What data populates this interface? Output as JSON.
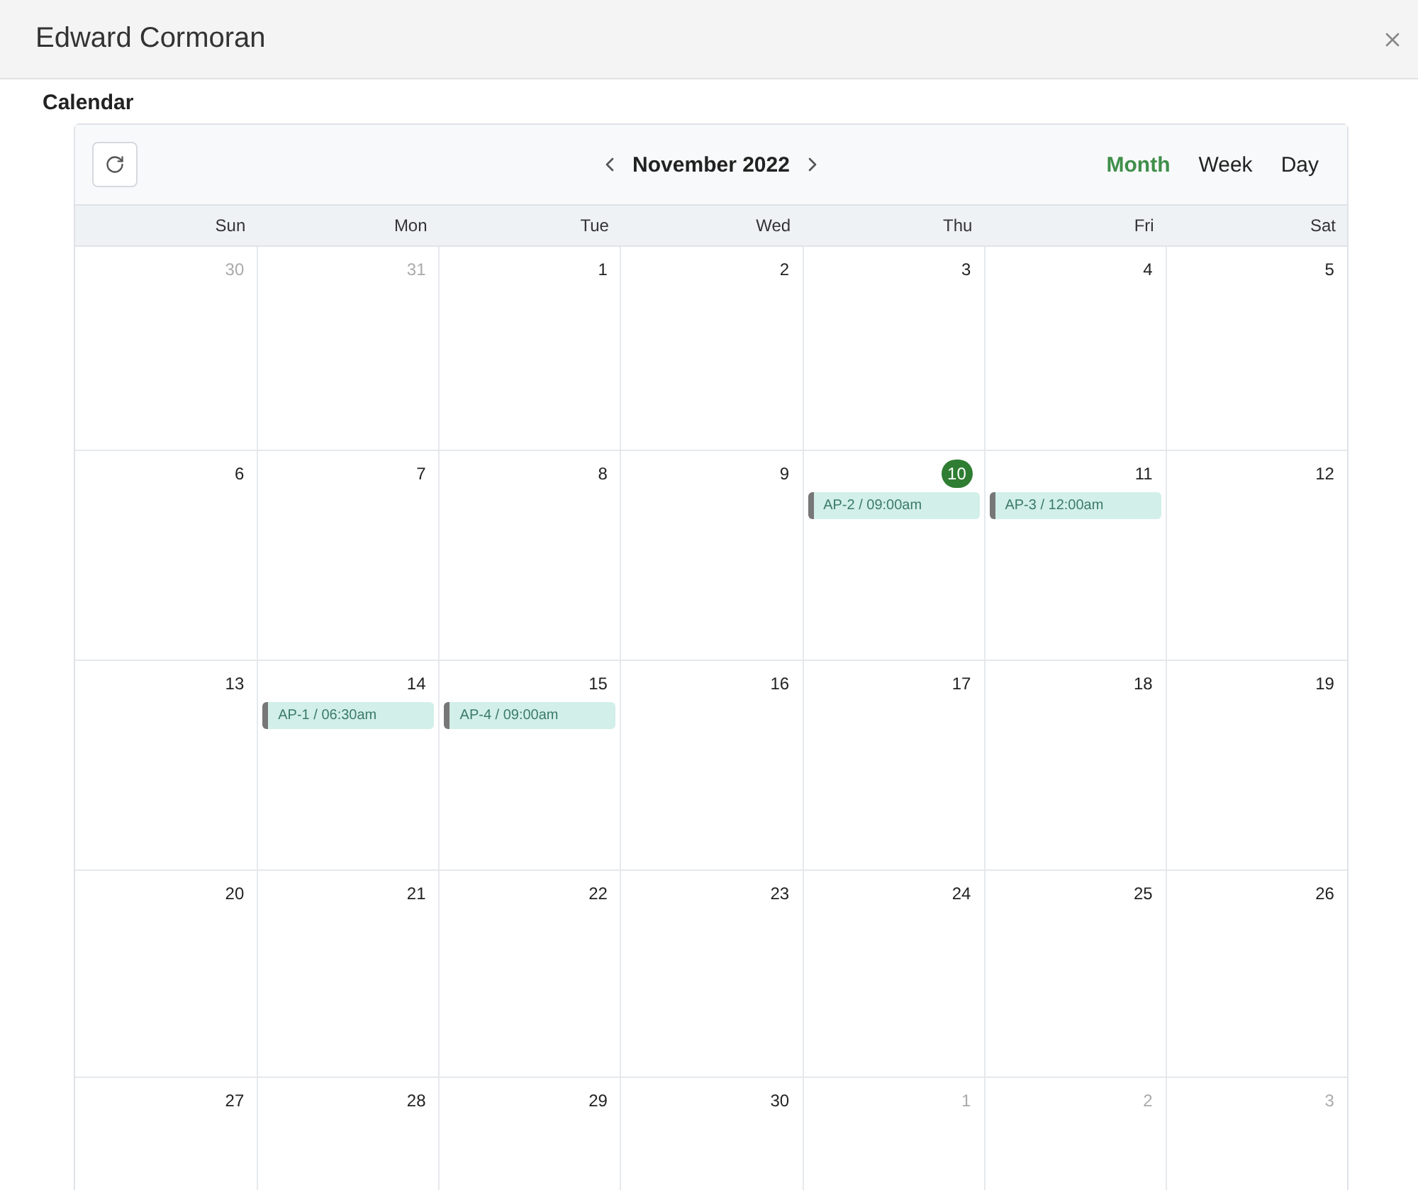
{
  "dialog": {
    "title": "Edward Cormoran"
  },
  "section_title": "Calendar",
  "toolbar": {
    "period": "November 2022",
    "views": [
      {
        "label": "Month",
        "selected": true
      },
      {
        "label": "Week",
        "selected": false
      },
      {
        "label": "Day",
        "selected": false
      }
    ]
  },
  "weekdays": [
    "Sun",
    "Mon",
    "Tue",
    "Wed",
    "Thu",
    "Fri",
    "Sat"
  ],
  "weeks": [
    [
      {
        "label": "30",
        "outside": true,
        "today": false
      },
      {
        "label": "31",
        "outside": true,
        "today": false
      },
      {
        "label": "1",
        "outside": false,
        "today": false
      },
      {
        "label": "2",
        "outside": false,
        "today": false
      },
      {
        "label": "3",
        "outside": false,
        "today": false
      },
      {
        "label": "4",
        "outside": false,
        "today": false
      },
      {
        "label": "5",
        "outside": false,
        "today": false
      }
    ],
    [
      {
        "label": "6",
        "outside": false,
        "today": false
      },
      {
        "label": "7",
        "outside": false,
        "today": false
      },
      {
        "label": "8",
        "outside": false,
        "today": false
      },
      {
        "label": "9",
        "outside": false,
        "today": false
      },
      {
        "label": "10",
        "outside": false,
        "today": true,
        "events": [
          "AP-2 / 09:00am"
        ]
      },
      {
        "label": "11",
        "outside": false,
        "today": false,
        "events": [
          "AP-3 / 12:00am"
        ]
      },
      {
        "label": "12",
        "outside": false,
        "today": false
      }
    ],
    [
      {
        "label": "13",
        "outside": false,
        "today": false
      },
      {
        "label": "14",
        "outside": false,
        "today": false,
        "events": [
          "AP-1 / 06:30am"
        ]
      },
      {
        "label": "15",
        "outside": false,
        "today": false,
        "events": [
          "AP-4 / 09:00am"
        ]
      },
      {
        "label": "16",
        "outside": false,
        "today": false
      },
      {
        "label": "17",
        "outside": false,
        "today": false
      },
      {
        "label": "18",
        "outside": false,
        "today": false
      },
      {
        "label": "19",
        "outside": false,
        "today": false
      }
    ],
    [
      {
        "label": "20",
        "outside": false,
        "today": false
      },
      {
        "label": "21",
        "outside": false,
        "today": false
      },
      {
        "label": "22",
        "outside": false,
        "today": false
      },
      {
        "label": "23",
        "outside": false,
        "today": false
      },
      {
        "label": "24",
        "outside": false,
        "today": false
      },
      {
        "label": "25",
        "outside": false,
        "today": false
      },
      {
        "label": "26",
        "outside": false,
        "today": false
      }
    ],
    [
      {
        "label": "27",
        "outside": false,
        "today": false
      },
      {
        "label": "28",
        "outside": false,
        "today": false
      },
      {
        "label": "29",
        "outside": false,
        "today": false
      },
      {
        "label": "30",
        "outside": false,
        "today": false
      },
      {
        "label": "1",
        "outside": true,
        "today": false
      },
      {
        "label": "2",
        "outside": true,
        "today": false
      },
      {
        "label": "3",
        "outside": true,
        "today": false
      }
    ]
  ]
}
